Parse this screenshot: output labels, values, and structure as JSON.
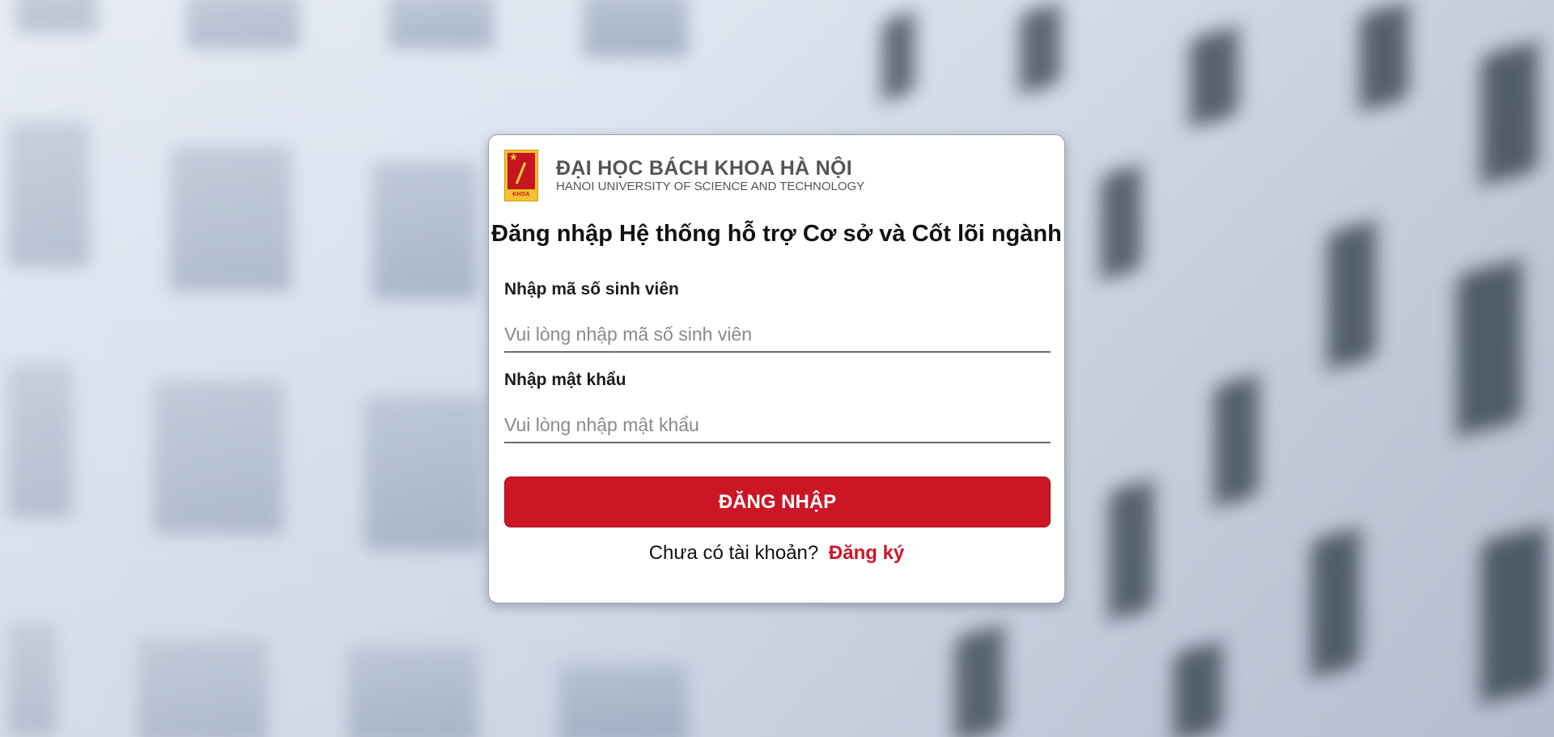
{
  "brand": {
    "logo_caption": "BÁCH KHOA",
    "name_vn": "ĐẠI HỌC BÁCH KHOA HÀ NỘI",
    "name_en": "HANOI UNIVERSITY OF SCIENCE AND TECHNOLOGY"
  },
  "form": {
    "title": "Đăng nhập Hệ thống hỗ trợ Cơ sở và Cốt lõi ngành",
    "student_id_label": "Nhập mã số sinh viên",
    "student_id_value": "",
    "student_id_placeholder": "Vui lòng nhập mã số sinh viên",
    "password_label": "Nhập mật khẩu",
    "password_value": "",
    "password_placeholder": "Vui lòng nhập mật khẩu",
    "login_label": "ĐĂNG NHẬP",
    "no_account_text": "Chưa có tài khoản?",
    "signup_label": "Đăng ký"
  },
  "colors": {
    "accent": "#cc1626",
    "text": "#111111",
    "brand_text": "#555555"
  }
}
